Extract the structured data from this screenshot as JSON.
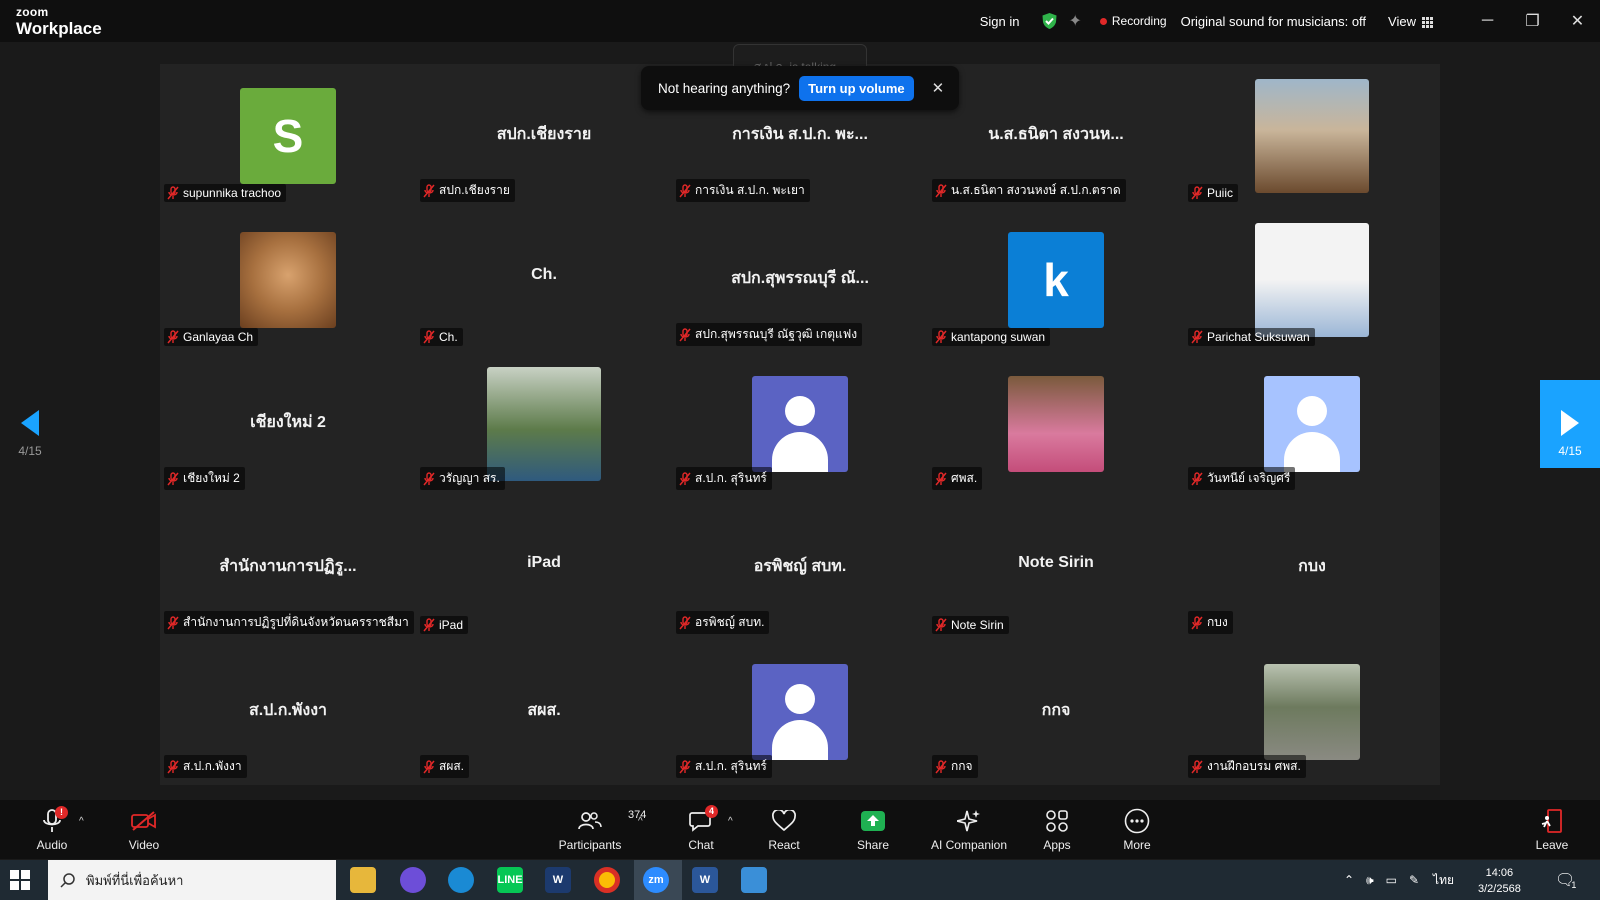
{
  "app": {
    "logo_line1": "zoom",
    "logo_line2": "Workplace"
  },
  "topbar": {
    "sign_in": "Sign in",
    "recording": "Recording",
    "original_sound": "Original sound for musicians: off",
    "view": "View",
    "minimize": "─",
    "restore": "❐",
    "close": "✕"
  },
  "talking_banner": "ส.ป.ก. is talking...",
  "volume_toast": {
    "text": "Not hearing anything?",
    "button": "Turn up volume",
    "close": "✕"
  },
  "pagination": {
    "left": "4/15",
    "right": "4/15"
  },
  "colors": {
    "accent_blue": "#0e72ed",
    "green_avatar": "#6aab3c",
    "blue_avatar": "#0b7fd6",
    "purple_avatar": "#5b63c3",
    "lightblue_avatar": "#a7c3ff",
    "record_red": "#e02828"
  },
  "participants": [
    {
      "display_name": "supunnika trachoo",
      "avatar": {
        "type": "letter",
        "letter": "S",
        "color": "#6aab3c"
      }
    },
    {
      "display_name": "สปก.เชียงราย",
      "avatar": {
        "type": "name",
        "text": "สปก.เชียงราย"
      }
    },
    {
      "display_name": "การเงิน ส.ป.ก. พะเยา",
      "avatar": {
        "type": "name",
        "text": "การเงิน ส.ป.ก. พะ..."
      }
    },
    {
      "display_name": "น.ส.ธนิตา สงวนหงษ์ ส.ป.ก.ตราด",
      "avatar": {
        "type": "name",
        "text": "น.ส.ธนิตา สงวนห..."
      }
    },
    {
      "display_name": "Puiic",
      "avatar": {
        "type": "photo",
        "icon": "photo-woman-cafe"
      }
    },
    {
      "display_name": "Ganlayaa Ch",
      "avatar": {
        "type": "photo",
        "icon": "photo-cat"
      }
    },
    {
      "display_name": "Ch.",
      "avatar": {
        "type": "name",
        "text": "Ch."
      }
    },
    {
      "display_name": "สปก.สุพรรณบุรี ณัฐวุฒิ เกตุแฟง",
      "avatar": {
        "type": "name",
        "text": "สปก.สุพรรณบุรี ณั..."
      }
    },
    {
      "display_name": "kantapong suwan",
      "avatar": {
        "type": "letter",
        "letter": "k",
        "color": "#0b7fd6"
      }
    },
    {
      "display_name": "Parichat Suksuwan",
      "avatar": {
        "type": "photo",
        "icon": "photo-woman-glasses"
      }
    },
    {
      "display_name": "เชียงใหม่ 2",
      "avatar": {
        "type": "name",
        "text": "เชียงใหม่ 2"
      }
    },
    {
      "display_name": "วรัญญา สร.",
      "avatar": {
        "type": "photo",
        "icon": "photo-man-forest"
      }
    },
    {
      "display_name": "ส.ป.ก. สุรินทร์",
      "avatar": {
        "type": "person",
        "color": "#5b63c3"
      }
    },
    {
      "display_name": "ศพส.",
      "avatar": {
        "type": "photo",
        "icon": "photo-girl-books"
      }
    },
    {
      "display_name": "วันทนีย์ เจริญศรี",
      "avatar": {
        "type": "person",
        "color": "#a7c3ff"
      }
    },
    {
      "display_name": "สำนักงานการปฏิรูปที่ดินจังหวัดนครราชสีมา",
      "avatar": {
        "type": "name",
        "text": "สำนักงานการปฏิรู..."
      }
    },
    {
      "display_name": "iPad",
      "avatar": {
        "type": "name",
        "text": "iPad"
      }
    },
    {
      "display_name": "อรพิชญ์ สบท.",
      "avatar": {
        "type": "name",
        "text": "อรพิชญ์ สบท."
      }
    },
    {
      "display_name": "Note Sirin",
      "avatar": {
        "type": "name",
        "text": "Note Sirin"
      }
    },
    {
      "display_name": "กบง",
      "avatar": {
        "type": "name",
        "text": "กบง"
      }
    },
    {
      "display_name": "ส.ป.ก.พังงา",
      "avatar": {
        "type": "name",
        "text": "ส.ป.ก.พังงา"
      }
    },
    {
      "display_name": "สผส.",
      "avatar": {
        "type": "name",
        "text": "สผส."
      }
    },
    {
      "display_name": "ส.ป.ก. สุรินทร์",
      "avatar": {
        "type": "person",
        "color": "#5b63c3"
      }
    },
    {
      "display_name": "กกจ",
      "avatar": {
        "type": "name",
        "text": "กกจ"
      }
    },
    {
      "display_name": "งานฝึกอบรม ศพส.",
      "avatar": {
        "type": "photo",
        "icon": "photo-man-road"
      }
    }
  ],
  "toolbar": {
    "audio": "Audio",
    "video": "Video",
    "participants": "Participants",
    "participant_count": "374",
    "chat": "Chat",
    "chat_badge": "4",
    "react": "React",
    "share": "Share",
    "ai_companion": "AI Companion",
    "apps": "Apps",
    "more": "More",
    "leave": "Leave"
  },
  "taskbar": {
    "search_placeholder": "พิมพ์ที่นี่เพื่อค้นหา",
    "language": "ไทย",
    "time": "14:06",
    "date": "3/2/2568",
    "notification_count": "1"
  }
}
